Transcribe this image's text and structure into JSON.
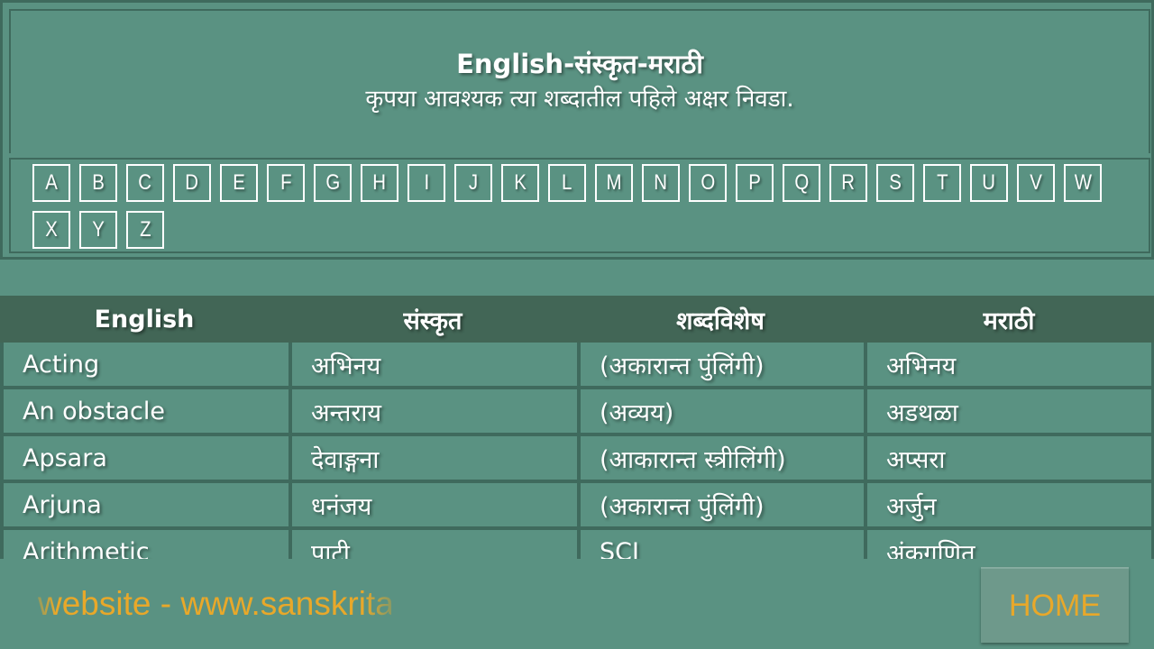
{
  "header": {
    "title": "English-संस्कृत-मराठी",
    "subtitle": "कृपया आवश्यक त्या शब्दातील पहिले अक्षर निवडा."
  },
  "alphabet": [
    "A",
    "B",
    "C",
    "D",
    "E",
    "F",
    "G",
    "H",
    "I",
    "J",
    "K",
    "L",
    "M",
    "N",
    "O",
    "P",
    "Q",
    "R",
    "S",
    "T",
    "U",
    "V",
    "W",
    "X",
    "Y",
    "Z"
  ],
  "table": {
    "columns": [
      "English",
      "संस्कृत",
      "शब्दविशेष",
      "मराठी"
    ],
    "rows": [
      [
        "Acting",
        "अभिनय",
        "(अकारान्त पुंलिंगी)",
        "अभिनय"
      ],
      [
        "An obstacle",
        "अन्तराय",
        "(अव्यय)",
        "अडथळा"
      ],
      [
        "Apsara",
        "देवाङ्गना",
        "(आकारान्त स्त्रीलिंगी)",
        "अप्सरा"
      ],
      [
        "Arjuna",
        "धनंजय",
        "(अकारान्त पुंलिंगी)",
        "अर्जुन"
      ],
      [
        "Arithmetic",
        "पाटी",
        "SCI",
        "अंकगणित"
      ]
    ]
  },
  "footer": {
    "website_text": "website - www.sanskritabharati.in",
    "home_label": "HOME"
  },
  "colors": {
    "background": "#5a9282",
    "border": "#3f6a5d",
    "table_header": "#426656",
    "accent_text": "#e8a82a",
    "text": "#ffffff"
  }
}
